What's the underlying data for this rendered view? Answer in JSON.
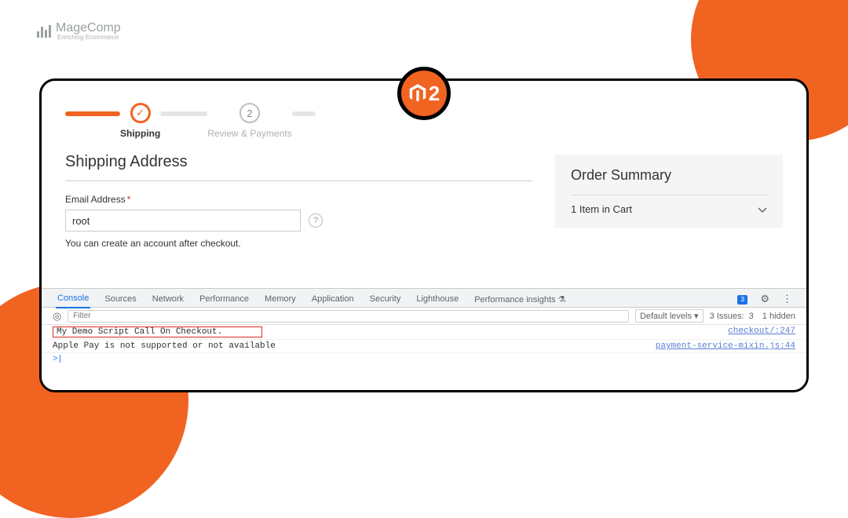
{
  "branding": {
    "name": "MageComp",
    "tagline": "Enriching Ecommerce",
    "badge_text": "2"
  },
  "checkout": {
    "steps": {
      "shipping": "Shipping",
      "review": "Review & Payments",
      "step2_num": "2"
    },
    "heading": "Shipping Address",
    "email_label": "Email Address",
    "email_value": "root",
    "hint": "You can create an account after checkout."
  },
  "sidebar": {
    "title": "Order Summary",
    "cart_line": "1 Item in Cart"
  },
  "devtools": {
    "tabs": [
      "Console",
      "Sources",
      "Network",
      "Performance",
      "Memory",
      "Application",
      "Security",
      "Lighthouse",
      "Performance insights"
    ],
    "messages_badge": "3",
    "filter_placeholder": "Filter",
    "levels": "Default levels ▾",
    "issues_label": "3 Issues:",
    "issues_count": "3",
    "hidden": "1 hidden",
    "log": [
      {
        "msg": "My Demo Script Call On Checkout.",
        "src": "checkout/:247",
        "hl": true
      },
      {
        "msg": "Apple Pay is not supported or not available",
        "src": "payment-service-mixin.js:44",
        "hl": false
      }
    ],
    "prompt": ">"
  }
}
